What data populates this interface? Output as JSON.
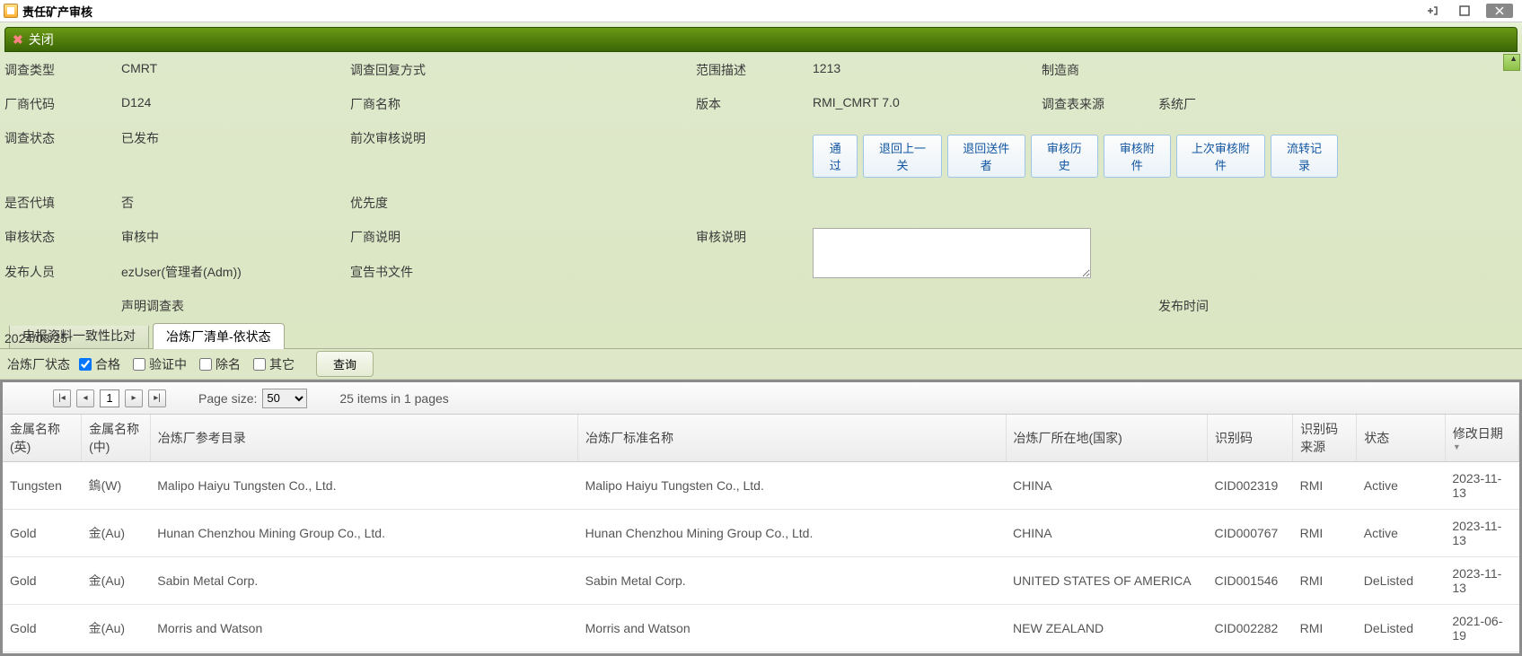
{
  "window": {
    "title": "责任矿产审核"
  },
  "toolbar": {
    "close_label": "关闭"
  },
  "form": {
    "labels": {
      "survey_type": "调查类型",
      "mfr_code": "厂商代码",
      "survey_status": "调查状态",
      "is_proxy": "是否代填",
      "audit_status": "审核状态",
      "publisher": "发布人员",
      "publish_time": "发布时间",
      "reply_mode": "调查回复方式",
      "mfr_name": "厂商名称",
      "prev_audit_note": "前次审核说明",
      "priority": "优先度",
      "mfr_note": "厂商说明",
      "declare_file": "宣告书文件",
      "declare_survey": "声明调查表",
      "scope_desc": "范围描述",
      "version": "版本",
      "audit_note": "审核说明",
      "manufacturer": "制造商",
      "survey_source": "调查表来源"
    },
    "values": {
      "survey_type": "CMRT",
      "mfr_code": "D124",
      "survey_status": "已发布",
      "is_proxy": "否",
      "audit_status": "审核中",
      "publisher": "ezUser(管理者(Adm))",
      "publish_time": "2024/03/25",
      "scope_desc": "1213",
      "version": "RMI_CMRT 7.0",
      "survey_source": "系统厂"
    },
    "buttons": {
      "approve": "通过",
      "return_prev": "退回上一关",
      "return_sender": "退回送件者",
      "audit_history": "审核历史",
      "audit_attach": "审核附件",
      "last_audit_attach": "上次审核附件",
      "flow_record": "流转记录"
    }
  },
  "tabs": {
    "t1": "申报资料一致性比对",
    "t2": "冶炼厂清单-依状态"
  },
  "filter": {
    "label": "冶炼厂状态",
    "opt_ok": "合格",
    "opt_verifying": "验证中",
    "opt_delisted": "除名",
    "opt_other": "其它",
    "query": "查询"
  },
  "pager": {
    "page": "1",
    "size_label": "Page size:",
    "size": "50",
    "summary": "25 items in 1 pages"
  },
  "table": {
    "headers": {
      "metal_en": "金属名称(英)",
      "metal_cn": "金属名称(中)",
      "ref_catalog": "冶炼厂参考目录",
      "std_name": "冶炼厂标准名称",
      "country": "冶炼厂所在地(国家)",
      "id": "识别码",
      "id_src": "识别码来源",
      "status": "状态",
      "mod_date": "修改日期"
    },
    "rows": [
      {
        "metal_en": "Tungsten",
        "metal_cn": "鎢(W)",
        "ref": "Malipo Haiyu Tungsten Co., Ltd.",
        "std": "Malipo Haiyu Tungsten Co., Ltd.",
        "country": "CHINA",
        "id": "CID002319",
        "src": "RMI",
        "status": "Active",
        "date": "2023-11-13"
      },
      {
        "metal_en": "Gold",
        "metal_cn": "金(Au)",
        "ref": "Hunan Chenzhou Mining Group Co., Ltd.",
        "std": "Hunan Chenzhou Mining Group Co., Ltd.",
        "country": "CHINA",
        "id": "CID000767",
        "src": "RMI",
        "status": "Active",
        "date": "2023-11-13"
      },
      {
        "metal_en": "Gold",
        "metal_cn": "金(Au)",
        "ref": "Sabin Metal Corp.",
        "std": "Sabin Metal Corp.",
        "country": "UNITED STATES OF AMERICA",
        "id": "CID001546",
        "src": "RMI",
        "status": "DeListed",
        "date": "2023-11-13"
      },
      {
        "metal_en": "Gold",
        "metal_cn": "金(Au)",
        "ref": "Morris and Watson",
        "std": "Morris and Watson",
        "country": "NEW ZEALAND",
        "id": "CID002282",
        "src": "RMI",
        "status": "DeListed",
        "date": "2021-06-19"
      }
    ]
  }
}
